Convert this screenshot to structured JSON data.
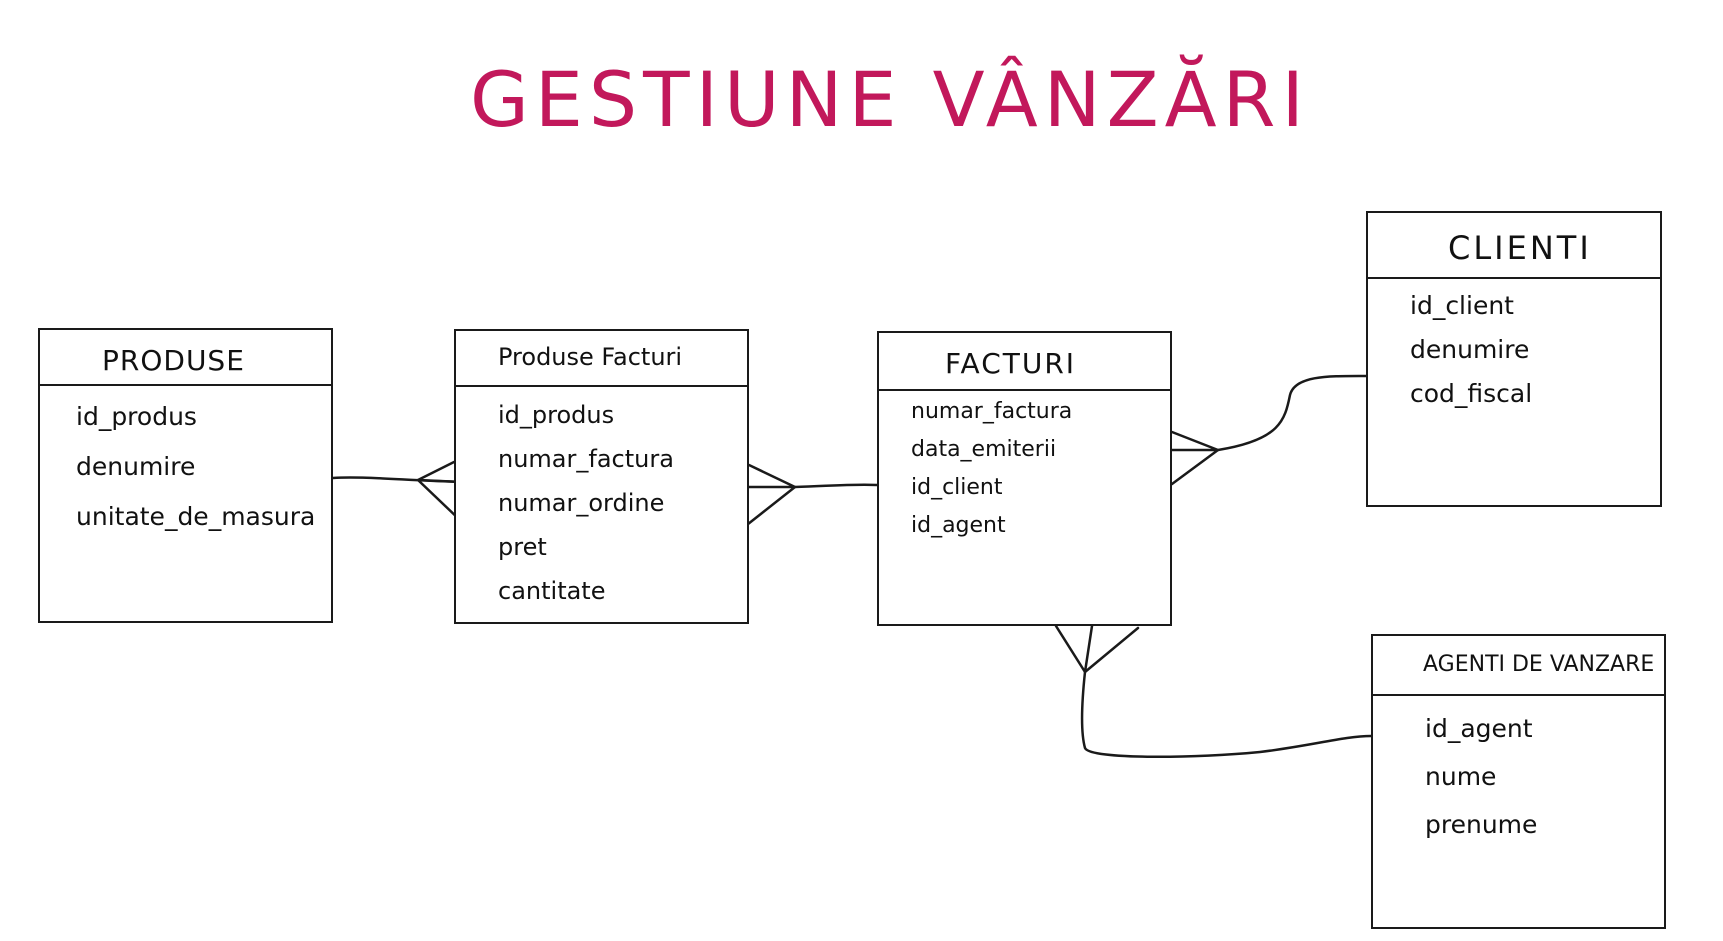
{
  "title": "GESTIUNE VÂNZĂRI",
  "colors": {
    "title": "#c2185b",
    "ink": "#1a1a1a"
  },
  "entities": [
    {
      "name": "PRODUSE",
      "fields": [
        "id_produs",
        "denumire",
        "unitate_de_masura"
      ]
    },
    {
      "name": "Produse Facturi",
      "fields": [
        "id_produs",
        "numar_factura",
        "numar_ordine",
        "pret",
        "cantitate"
      ]
    },
    {
      "name": "FACTURI",
      "fields": [
        "numar_factura",
        "data_emiterii",
        "id_client",
        "id_agent"
      ]
    },
    {
      "name": "CLIENTI",
      "fields": [
        "id_client",
        "denumire",
        "cod_fiscal"
      ]
    },
    {
      "name": "AGENTI DE VANZARE",
      "fields": [
        "id_agent",
        "nume",
        "prenume"
      ]
    }
  ]
}
